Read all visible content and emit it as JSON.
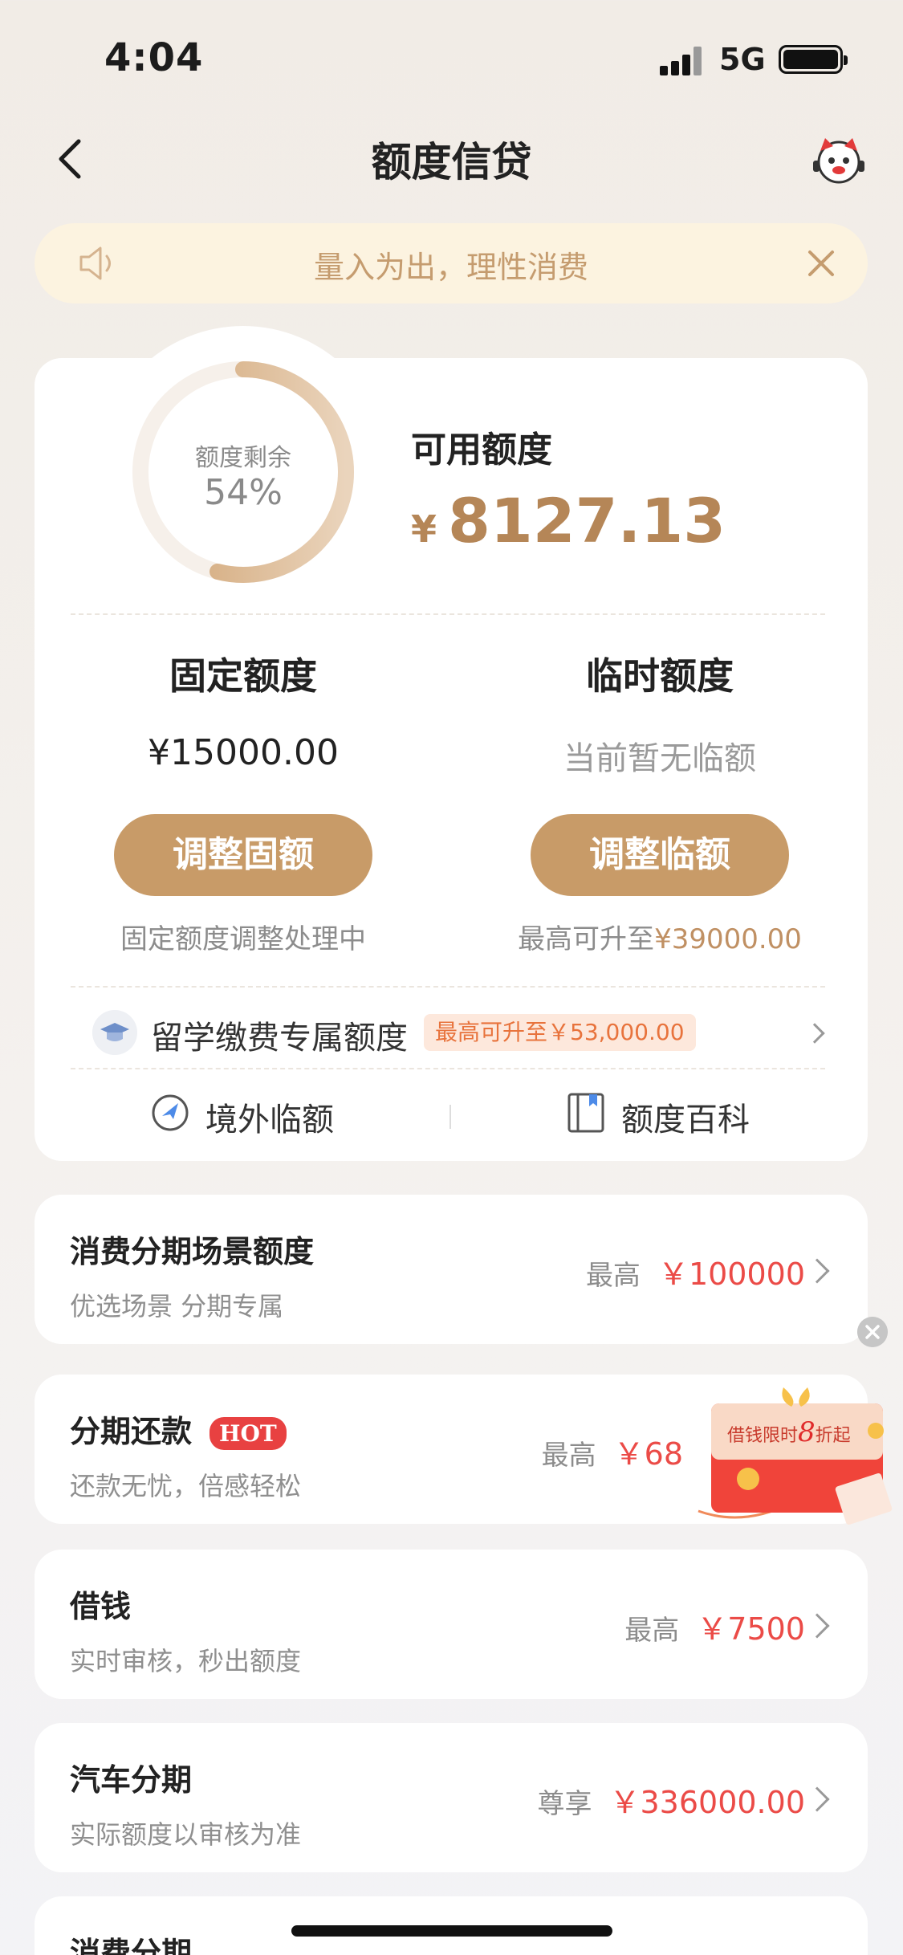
{
  "status_bar": {
    "time": "4:04",
    "network": "5G"
  },
  "nav": {
    "title": "额度信贷"
  },
  "notice": {
    "text": "量入为出，理性消费"
  },
  "summary": {
    "ring_label": "额度剩余",
    "ring_percent_text": "54%",
    "remaining_fraction": 0.54,
    "available_label": "可用额度",
    "currency": "¥",
    "available_amount": "8127.13"
  },
  "fixed": {
    "label": "固定额度",
    "value": "¥15000.00",
    "button": "调整固额",
    "note": "固定额度调整处理中"
  },
  "temporary": {
    "label": "临时额度",
    "value": "当前暂无临额",
    "button": "调整临额",
    "note_prefix": "最高可升至",
    "note_amount": "¥39000.00"
  },
  "study_abroad": {
    "label": "留学缴费专属额度",
    "badge": "最高可升至￥53,000.00"
  },
  "links": {
    "overseas": "境外临额",
    "wiki": "额度百科"
  },
  "rows": [
    {
      "title": "消费分期场景额度",
      "subtitle": "优选场景 分期专属",
      "prefix": "最高",
      "amount": "￥100000"
    },
    {
      "title": "分期还款",
      "badge": "HOT",
      "subtitle": "还款无忧，倍感轻松",
      "prefix": "最高",
      "amount": "￥68"
    },
    {
      "title": "借钱",
      "subtitle": "实时审核，秒出额度",
      "prefix": "最高",
      "amount": "￥7500"
    },
    {
      "title": "汽车分期",
      "subtitle": "实际额度以审核为准",
      "prefix": "尊享",
      "amount": "￥336000.00"
    },
    {
      "title": "消费分期"
    }
  ],
  "promo": {
    "text_a": "借钱限时",
    "text_num": "8",
    "text_b": "折起"
  },
  "colors": {
    "accent": "#c89b68",
    "amount_red": "#eb4b47",
    "hot": "#e84141"
  }
}
